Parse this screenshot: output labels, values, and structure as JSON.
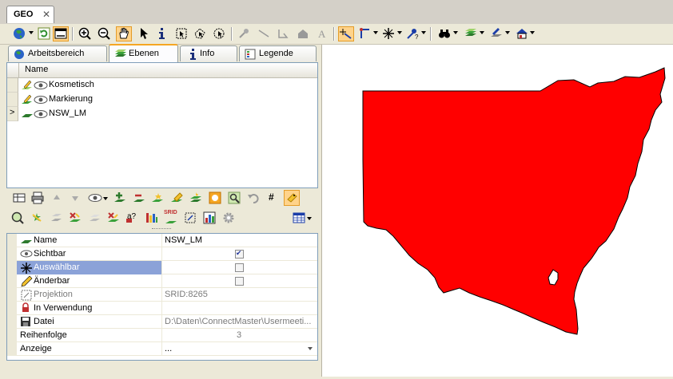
{
  "document_tab": {
    "label": "GEO",
    "close": "✕"
  },
  "panel_tabs": [
    {
      "label": "Arbeitsbereich",
      "icon": "globe-icon"
    },
    {
      "label": "Ebenen",
      "icon": "layers-icon",
      "selected": true
    },
    {
      "label": "Info",
      "icon": "info-icon"
    },
    {
      "label": "Legende",
      "icon": "legend-icon"
    }
  ],
  "layer_list": {
    "header": "Name",
    "current_marker": ">",
    "rows": [
      {
        "name": "Kosmetisch"
      },
      {
        "name": "Markierung"
      },
      {
        "name": "NSW_LM",
        "current": true
      }
    ]
  },
  "layer_toolbar": {
    "hash_label": "#",
    "spatial_label": "a?",
    "sql_label": "SRID"
  },
  "properties": {
    "rows": [
      {
        "label": "Name",
        "value": "NSW_LM",
        "type": "text"
      },
      {
        "label": "Sichtbar",
        "checked": true,
        "type": "checkbox"
      },
      {
        "label": "Auswählbar",
        "checked": false,
        "type": "checkbox",
        "selected": true
      },
      {
        "label": "Änderbar",
        "checked": false,
        "type": "checkbox"
      },
      {
        "label": "Projektion",
        "value": "SRID:8265",
        "type": "text",
        "disabled": true
      },
      {
        "label": "In Verwendung",
        "value": "",
        "type": "text"
      },
      {
        "label": "Datei",
        "value": "D:\\Daten\\ConnectMaster\\Usermeeti...",
        "type": "text",
        "muted": true
      },
      {
        "label": "Reihenfolge",
        "value": "3",
        "type": "number",
        "muted": true
      },
      {
        "label": "Anzeige",
        "value": "...",
        "type": "dropdown"
      }
    ]
  },
  "map": {
    "fill_color": "#ff0000",
    "stroke_color": "#000000",
    "background": "#ffffff"
  },
  "colors": {
    "active_tool": "#ffd38a",
    "selection": "#8ba2d8",
    "tab_accent": "#f5a623"
  }
}
